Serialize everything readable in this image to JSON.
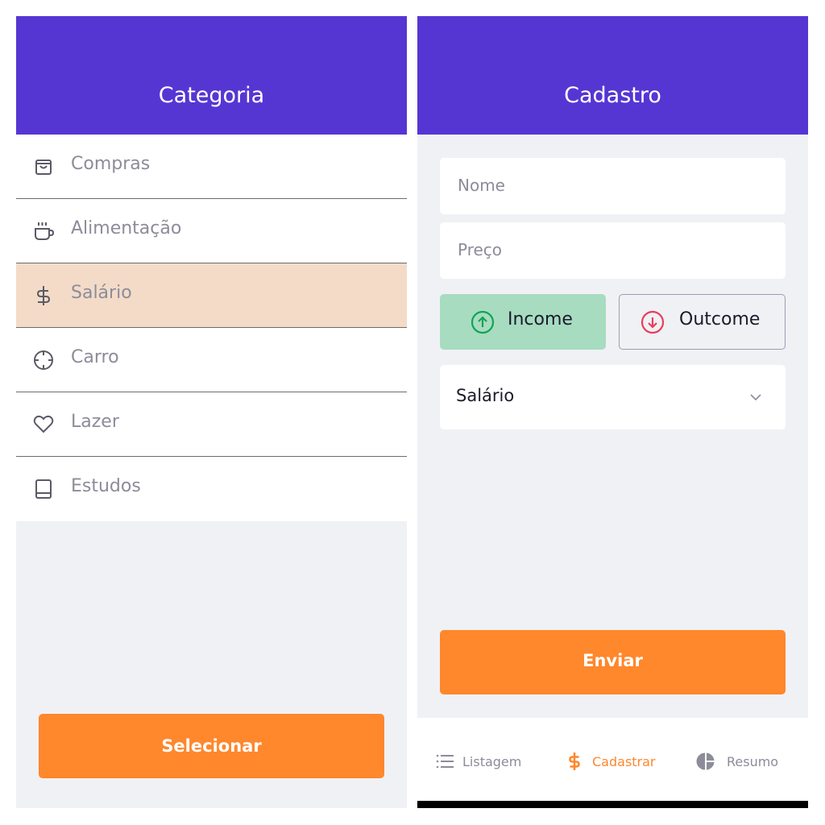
{
  "category_screen": {
    "title": "Categoria",
    "items": [
      {
        "label": "Compras",
        "icon": "shopping-bag-icon"
      },
      {
        "label": "Alimentação",
        "icon": "coffee-icon"
      },
      {
        "label": "Salário",
        "icon": "dollar-icon",
        "selected": true
      },
      {
        "label": "Carro",
        "icon": "crosshair-icon"
      },
      {
        "label": "Lazer",
        "icon": "heart-icon"
      },
      {
        "label": "Estudos",
        "icon": "book-icon"
      }
    ],
    "select_button": "Selecionar"
  },
  "register_screen": {
    "title": "Cadastro",
    "name_placeholder": "Nome",
    "price_placeholder": "Preço",
    "income_label": "Income",
    "outcome_label": "Outcome",
    "category_value": "Salário",
    "submit_button": "Enviar"
  },
  "tabbar": {
    "tabs": [
      {
        "label": "Listagem",
        "icon": "list-icon"
      },
      {
        "label": "Cadastrar",
        "icon": "dollar-icon",
        "active": true
      },
      {
        "label": "Resumo",
        "icon": "pie-chart-icon"
      }
    ]
  },
  "colors": {
    "primary": "#5636d3",
    "secondary": "#ff872c",
    "selected_item": "#f3dbc8",
    "income_green": "#12a454",
    "income_bg": "#a7dcc0",
    "outcome_red": "#e83f5b",
    "text_muted": "#8c8c9a",
    "background": "#f0f1f5"
  }
}
